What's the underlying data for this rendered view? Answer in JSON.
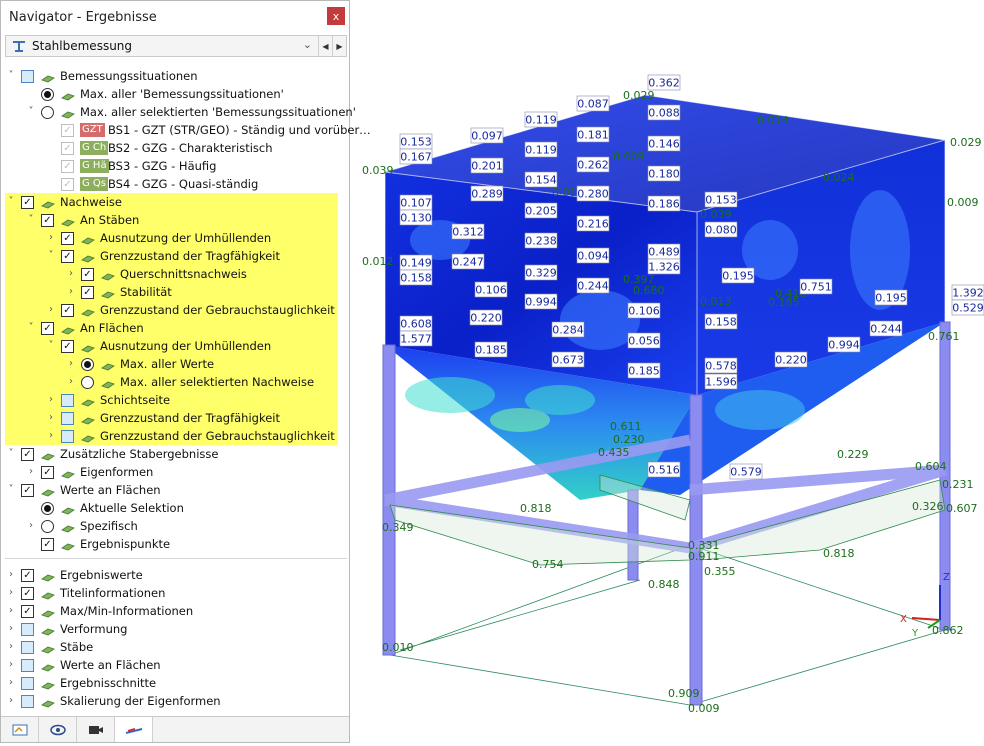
{
  "window": {
    "title": "Navigator - Ergebnisse",
    "close": "x"
  },
  "combo": {
    "value": "Stahlbemessung"
  },
  "tree": [
    {
      "label": "Bemessungssituationen",
      "exp": "v",
      "indent": 0,
      "ctrl": "partial"
    },
    {
      "label": "Max. aller 'Bemessungssituationen'",
      "indent": 1,
      "ctrl": "radio-on"
    },
    {
      "label": "Max. aller selektierten 'Bemessungssituationen'",
      "exp": "v",
      "indent": 1,
      "ctrl": "radio-off"
    },
    {
      "tag": "GZT",
      "tagColor": "#d56c6c",
      "label": "BS1 - GZT (STR/GEO) - Ständig und vorüber…",
      "indent": 2,
      "ctrl": "dis"
    },
    {
      "tag": "G Ch",
      "tagColor": "#8dae5d",
      "label": "BS2 - GZG - Charakteristisch",
      "indent": 2,
      "ctrl": "dis"
    },
    {
      "tag": "G Hä",
      "tagColor": "#8dae5d",
      "label": "BS3 - GZG - Häufig",
      "indent": 2,
      "ctrl": "dis"
    },
    {
      "tag": "G Qs",
      "tagColor": "#8dae5d",
      "label": "BS4 - GZG - Quasi-ständig",
      "indent": 2,
      "ctrl": "dis"
    },
    {
      "label": "Nachweise",
      "exp": "v",
      "indent": 0,
      "ctrl": "check"
    },
    {
      "label": "An Stäben",
      "exp": "v",
      "indent": 1,
      "ctrl": "check"
    },
    {
      "label": "Ausnutzung der Umhüllenden",
      "exp": ">",
      "indent": 2,
      "ctrl": "check"
    },
    {
      "label": "Grenzzustand der Tragfähigkeit",
      "exp": "v",
      "indent": 2,
      "ctrl": "check"
    },
    {
      "label": "Querschnittsnachweis",
      "exp": ">",
      "indent": 3,
      "ctrl": "check"
    },
    {
      "label": "Stabilität",
      "exp": ">",
      "indent": 3,
      "ctrl": "check"
    },
    {
      "label": "Grenzzustand der Gebrauchstauglichkeit",
      "exp": ">",
      "indent": 2,
      "ctrl": "check"
    },
    {
      "label": "An Flächen",
      "exp": "v",
      "indent": 1,
      "ctrl": "check"
    },
    {
      "label": "Ausnutzung der Umhüllenden",
      "exp": "v",
      "indent": 2,
      "ctrl": "check"
    },
    {
      "label": "Max. aller Werte",
      "exp": ">",
      "indent": 3,
      "ctrl": "radio-on"
    },
    {
      "label": "Max. aller selektierten Nachweise",
      "exp": ">",
      "indent": 3,
      "ctrl": "radio-off"
    },
    {
      "label": "Schichtseite",
      "exp": ">",
      "indent": 2,
      "ctrl": "partial"
    },
    {
      "label": "Grenzzustand der Tragfähigkeit",
      "exp": ">",
      "indent": 2,
      "ctrl": "partial"
    },
    {
      "label": "Grenzzustand der Gebrauchstauglichkeit",
      "exp": ">",
      "indent": 2,
      "ctrl": "partial"
    },
    {
      "label": "Zusätzliche Stabergebnisse",
      "exp": "v",
      "indent": 0,
      "ctrl": "check"
    },
    {
      "label": "Eigenformen",
      "exp": ">",
      "indent": 1,
      "ctrl": "check"
    },
    {
      "label": "Werte an Flächen",
      "exp": "v",
      "indent": 0,
      "ctrl": "check"
    },
    {
      "label": "Aktuelle Selektion",
      "indent": 1,
      "ctrl": "radio-on"
    },
    {
      "label": "Spezifisch",
      "exp": ">",
      "indent": 1,
      "ctrl": "radio-off"
    },
    {
      "label": "Ergebnispunkte",
      "indent": 1,
      "ctrl": "check"
    }
  ],
  "tree2": [
    {
      "label": "Ergebniswerte",
      "exp": ">",
      "ctrl": "check"
    },
    {
      "label": "Titelinformationen",
      "exp": ">",
      "ctrl": "check"
    },
    {
      "label": "Max/Min-Informationen",
      "exp": ">",
      "ctrl": "check"
    },
    {
      "label": "Verformung",
      "exp": ">",
      "ctrl": "partial"
    },
    {
      "label": "Stäbe",
      "exp": ">",
      "ctrl": "partial"
    },
    {
      "label": "Werte an Flächen",
      "exp": ">",
      "ctrl": "partial"
    },
    {
      "label": "Ergebnisschnitte",
      "exp": ">",
      "ctrl": "partial"
    },
    {
      "label": "Skalierung der Eigenformen",
      "exp": ">",
      "ctrl": "partial"
    }
  ],
  "bottom_tabs": [
    "data-icon",
    "eye-icon",
    "camera-icon",
    "results-icon"
  ],
  "model_labels": {
    "boxed": [
      "0.362",
      "0.087",
      "0.088",
      "0.119",
      "0.181",
      "0.146",
      "0.097",
      "0.119",
      "0.262",
      "0.180",
      "0.153",
      "0.167",
      "0.201",
      "0.154",
      "0.280",
      "0.186",
      "0.289",
      "0.205",
      "0.216",
      "0.153",
      "0.080",
      "0.107",
      "0.130",
      "0.312",
      "0.238",
      "0.094",
      "0.489",
      "1.326",
      "0.149",
      "0.158",
      "0.247",
      "0.329",
      "0.244",
      "0.195",
      "0.751",
      "0.195",
      "1.392",
      "0.529",
      "0.106",
      "0.994",
      "0.106",
      "0.608",
      "1.577",
      "0.220",
      "0.284",
      "0.056",
      "0.158",
      "0.244",
      "0.185",
      "0.673",
      "0.185",
      "0.578",
      "1.596",
      "0.220",
      "0.994",
      "0.516",
      "0.579"
    ],
    "green": [
      "0.029",
      "0.014",
      "0.029",
      "0.039",
      "0.009",
      "0.024",
      "0.009",
      "0.012",
      "0.011",
      "0.039",
      "0.397",
      "0.680",
      "0.418",
      "0.185",
      "0.013",
      "0.761",
      "0.611",
      "0.230",
      "0.435",
      "0.229",
      "0.604",
      "0.231",
      "0.818",
      "0.326",
      "0.607",
      "0.349",
      "0.754",
      "0.331",
      "0.911",
      "0.355",
      "0.818",
      "0.848",
      "0.010",
      "0.909",
      "0.009",
      "0.862"
    ]
  },
  "axes": {
    "x": "X",
    "y": "Y",
    "z": "Z"
  }
}
